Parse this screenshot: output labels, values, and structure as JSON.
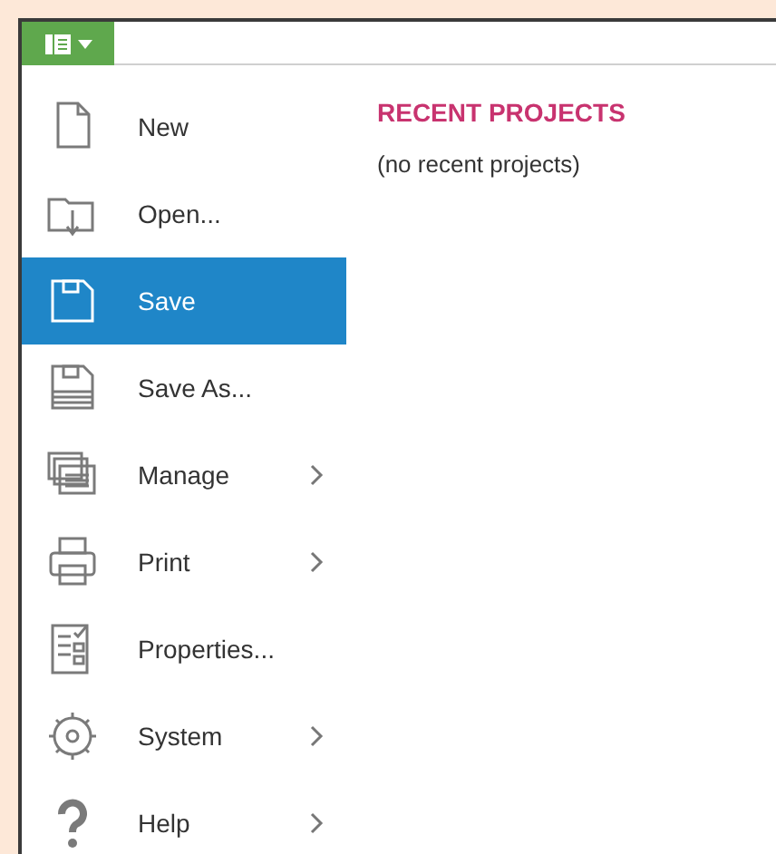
{
  "menu": {
    "items": [
      {
        "label": "New",
        "selected": false,
        "submenu": false
      },
      {
        "label": "Open...",
        "selected": false,
        "submenu": false
      },
      {
        "label": "Save",
        "selected": true,
        "submenu": false
      },
      {
        "label": "Save As...",
        "selected": false,
        "submenu": false
      },
      {
        "label": "Manage",
        "selected": false,
        "submenu": true
      },
      {
        "label": "Print",
        "selected": false,
        "submenu": true
      },
      {
        "label": "Properties...",
        "selected": false,
        "submenu": false
      },
      {
        "label": "System",
        "selected": false,
        "submenu": true
      },
      {
        "label": "Help",
        "selected": false,
        "submenu": true
      }
    ]
  },
  "recent": {
    "title": "RECENT PROJECTS",
    "empty_text": "(no recent projects)"
  }
}
